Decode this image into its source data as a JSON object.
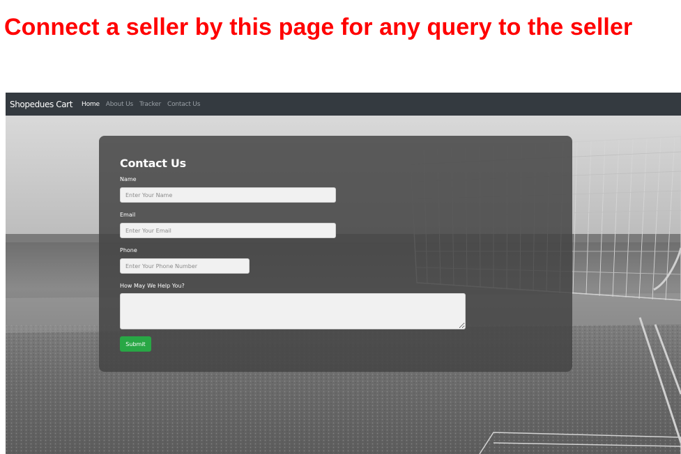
{
  "caption": "Connect a seller by this page for any query to the seller",
  "navbar": {
    "brand": "Shopedues Cart",
    "links": [
      "Home",
      "About Us",
      "Tracker",
      "Contact Us"
    ],
    "active": "Home",
    "background": "#343a40"
  },
  "form": {
    "title": "Contact Us",
    "name_label": "Name",
    "name_placeholder": "Enter Your Name",
    "email_label": "Email",
    "email_placeholder": "Enter Your Email",
    "phone_label": "Phone",
    "phone_placeholder": "Enter Your Phone Number",
    "help_label": "How May We Help You?",
    "help_placeholder": "",
    "submit_label": "Submit",
    "submit_color": "#28a745"
  },
  "colors": {
    "caption": "#ff0000",
    "panel": "#444444"
  },
  "background": {
    "description_icon": "shopping-cart-photo"
  }
}
